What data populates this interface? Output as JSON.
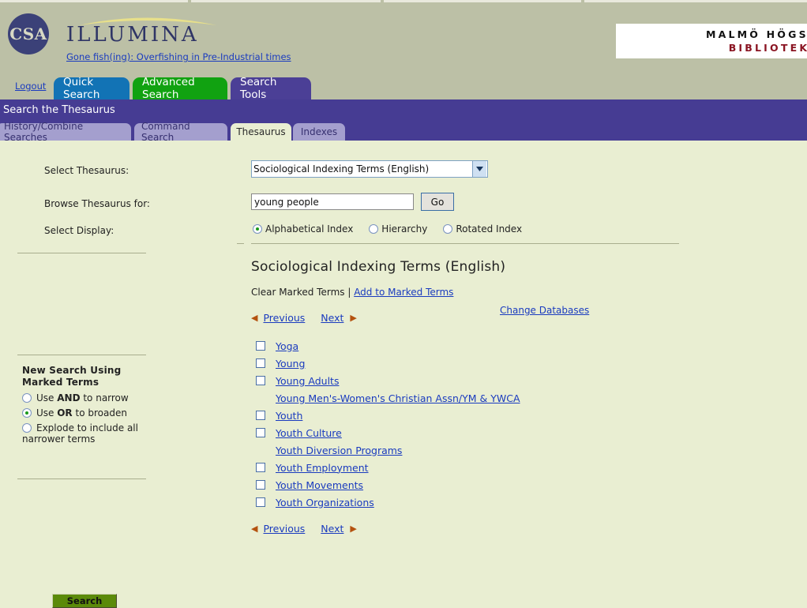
{
  "header": {
    "brand_logo_text": "CSA",
    "brand_name": "ILLUMINA",
    "tagline": "Gone fish(ing): Overfishing in Pre-Industrial times",
    "institution_line1": "MALMÖ HÖGSKOLA",
    "institution_line2": "BIBLIOTEK & IT",
    "colors": {
      "header_bg": "#bcc0a6",
      "brand_navy": "#3b4178",
      "arc_yellow": "#e8e08a",
      "institution_red": "#8a1422"
    }
  },
  "nav": {
    "logout_label": "Logout",
    "tabs": [
      {
        "label": "Quick Search",
        "color": "#1273b5"
      },
      {
        "label": "Advanced Search",
        "color": "#11a211"
      },
      {
        "label": "Search Tools",
        "color": "#4b3f96"
      }
    ]
  },
  "banner": {
    "title": "Search the Thesaurus",
    "color": "#463c93",
    "subtabs": [
      {
        "label": "History/Combine Searches",
        "active": false
      },
      {
        "label": "Command Search",
        "active": false
      },
      {
        "label": "Thesaurus",
        "active": true
      },
      {
        "label": "Indexes",
        "active": false
      }
    ]
  },
  "form": {
    "thesaurus_label": "Select Thesaurus:",
    "thesaurus_value": "Sociological Indexing Terms (English)",
    "thesaurus_options": [
      "Sociological Indexing Terms (English)"
    ],
    "change_databases_label": "Change Databases",
    "browse_label": "Browse Thesaurus for:",
    "browse_value": "young people",
    "browse_placeholder": "",
    "go_label": "Go",
    "display_label": "Select Display:",
    "display_options": [
      {
        "label": "Alphabetical Index",
        "selected": true
      },
      {
        "label": "Hierarchy",
        "selected": false
      },
      {
        "label": "Rotated Index",
        "selected": false
      }
    ]
  },
  "results": {
    "title": "Sociological Indexing Terms (English)",
    "clear_marked_label": "Clear Marked Terms",
    "separator": " | ",
    "add_marked_label": "Add to Marked Terms",
    "pager": {
      "previous_label": "Previous",
      "next_label": "Next",
      "prev_arrow": "◀",
      "next_arrow": "▶"
    },
    "terms": [
      {
        "label": "Yoga",
        "has_checkbox": true,
        "checked": false
      },
      {
        "label": "Young",
        "has_checkbox": true,
        "checked": false
      },
      {
        "label": "Young Adults",
        "has_checkbox": true,
        "checked": false
      },
      {
        "label": "Young Men's-Women's Christian Assn/YM & YWCA",
        "has_checkbox": false,
        "checked": false
      },
      {
        "label": "Youth",
        "has_checkbox": true,
        "checked": false
      },
      {
        "label": "Youth Culture",
        "has_checkbox": true,
        "checked": false
      },
      {
        "label": "Youth Diversion Programs",
        "has_checkbox": false,
        "checked": false
      },
      {
        "label": "Youth Employment",
        "has_checkbox": true,
        "checked": false
      },
      {
        "label": "Youth Movements",
        "has_checkbox": true,
        "checked": false
      },
      {
        "label": "Youth Organizations",
        "has_checkbox": true,
        "checked": false
      }
    ]
  },
  "sidebar": {
    "marked_title_line1": "New Search Using",
    "marked_title_line2": "Marked Terms",
    "options": [
      {
        "pre": "Use ",
        "bold": "AND",
        "post": " to narrow",
        "selected": false
      },
      {
        "pre": "Use ",
        "bold": "OR",
        "post": " to broaden",
        "selected": true
      },
      {
        "pre": "Explode to include all",
        "bold": "",
        "post": "",
        "selected": false
      }
    ],
    "explode_continuation": "narrower terms",
    "search_button_label": "Search",
    "search_button_color": "#5b8a0a"
  }
}
